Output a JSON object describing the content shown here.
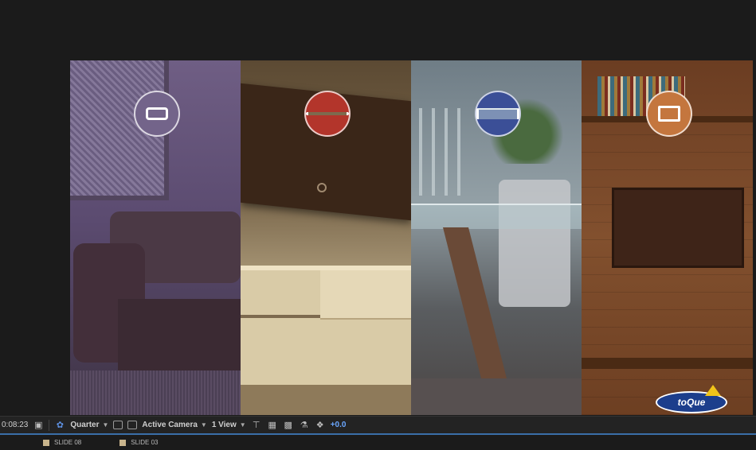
{
  "toolbar": {
    "timecode": "0:08:23",
    "resolution": "Quarter",
    "camera": "Active Camera",
    "views": "1 View",
    "exposure": "+0.0"
  },
  "tabs": [
    {
      "label": "SLIDE 08"
    },
    {
      "label": "SLIDE 03"
    }
  ],
  "composition": {
    "panels": [
      {
        "icon": "sofa-icon",
        "color": "#73648a"
      },
      {
        "icon": "tv-shelf-icon",
        "color": "#b3352b"
      },
      {
        "icon": "table-icon",
        "color": "#3b4f97"
      },
      {
        "icon": "chair-icon",
        "color": "#c4763e"
      }
    ],
    "logo_text": "toQue"
  },
  "colors": {
    "accent": "#6aa7ff",
    "tab_underline": "#3a6fa8",
    "panel_bg": "#232323"
  }
}
